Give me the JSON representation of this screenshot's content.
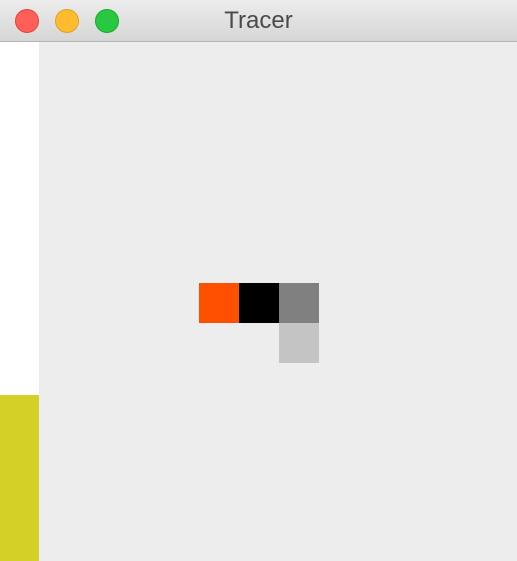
{
  "window": {
    "title": "Tracer",
    "controls": {
      "close_color": "#ff5f57",
      "close_border": "#e0443e",
      "minimize_color": "#febc2e",
      "minimize_border": "#dea123",
      "maximize_color": "#28c840",
      "maximize_border": "#1aab29"
    }
  },
  "canvas": {
    "background": "#ededed",
    "sidebar": {
      "background": "#ffffff",
      "level_fraction": 0.32,
      "level_color": "#d4d028"
    },
    "cells": [
      {
        "col": 0,
        "row": 0,
        "color": "#ff5000"
      },
      {
        "col": 1,
        "row": 0,
        "color": "#000000"
      },
      {
        "col": 2,
        "row": 0,
        "color": "#808080"
      },
      {
        "col": 2,
        "row": 1,
        "color": "#c4c4c4"
      }
    ]
  }
}
